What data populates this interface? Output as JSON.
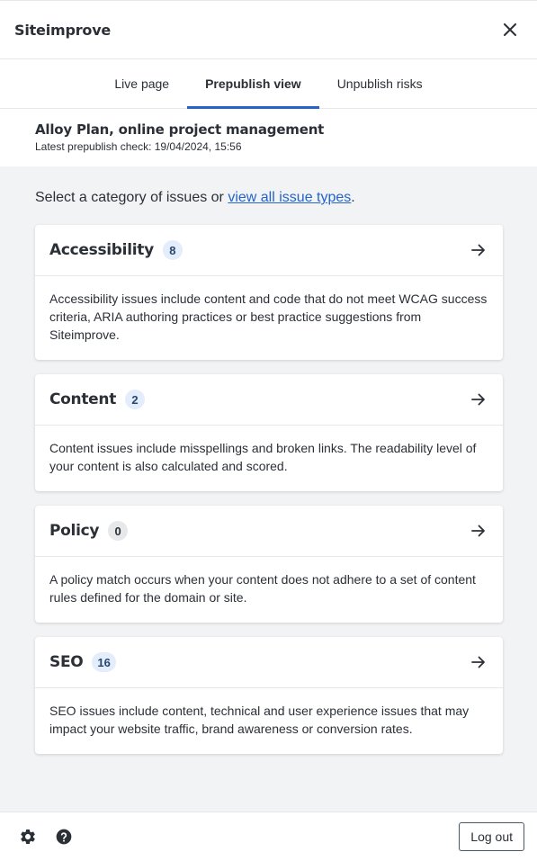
{
  "header": {
    "title": "Siteimprove"
  },
  "tabs": [
    {
      "label": "Live page"
    },
    {
      "label": "Prepublish view"
    },
    {
      "label": "Unpublish risks"
    }
  ],
  "active_tab": "Prepublish view",
  "page": {
    "title": "Alloy Plan, online project management",
    "subtitle": "Latest prepublish check: 19/04/2024, 15:56"
  },
  "intro": {
    "text": "Select a category of issues or ",
    "link": "view all issue types",
    "suffix": "."
  },
  "categories": [
    {
      "name": "Accessibility",
      "count": "8",
      "description": "Accessibility issues include content and code that do not meet WCAG success criteria, ARIA authoring practices or best practice suggestions from Siteimprove."
    },
    {
      "name": "Content",
      "count": "2",
      "description": "Content issues include misspellings and broken links. The readability level of your content is also calculated and scored."
    },
    {
      "name": "Policy",
      "count": "0",
      "description": "A policy match occurs when your content does not adhere to a set of content rules defined for the domain or site."
    },
    {
      "name": "SEO",
      "count": "16",
      "description": "SEO issues include content, technical and user experience issues that may impact your website traffic, brand awareness or conversion rates."
    }
  ],
  "footer": {
    "logout_label": "Log out"
  },
  "icons": {
    "close": "close-icon",
    "arrow": "arrow-right-icon",
    "settings": "gear-icon",
    "help": "help-icon"
  },
  "colors": {
    "accent": "#2563c9",
    "badge_blue": "#e3edfb",
    "badge_grey": "#e7e8ea",
    "background": "#f2f3f4"
  }
}
